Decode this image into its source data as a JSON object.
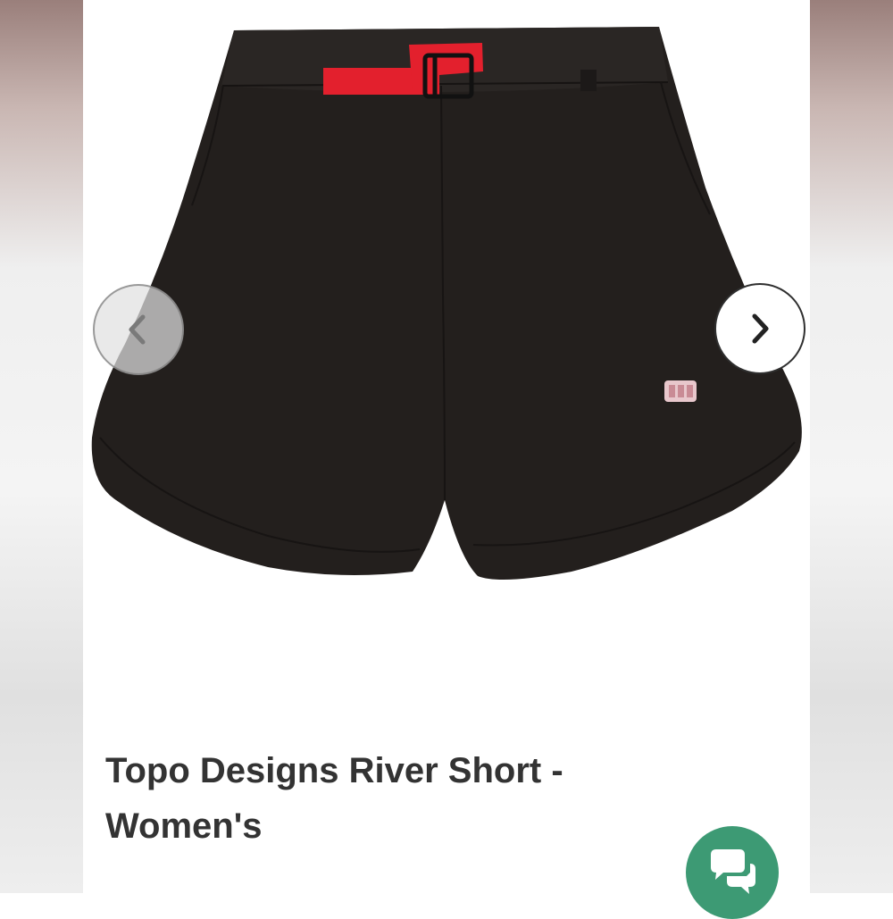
{
  "product": {
    "title": "Topo Designs River Short - Women's",
    "image": "black-river-shorts-with-red-buckle-belt",
    "carousel": {
      "prev_icon": "chevron-left-icon",
      "next_icon": "chevron-right-icon"
    }
  },
  "chat": {
    "icon": "chat-bubbles-icon"
  },
  "colors": {
    "shorts": "#231f1d",
    "belt": "#e3202d",
    "chat_button": "#3d9a74",
    "title_text": "#333333"
  }
}
